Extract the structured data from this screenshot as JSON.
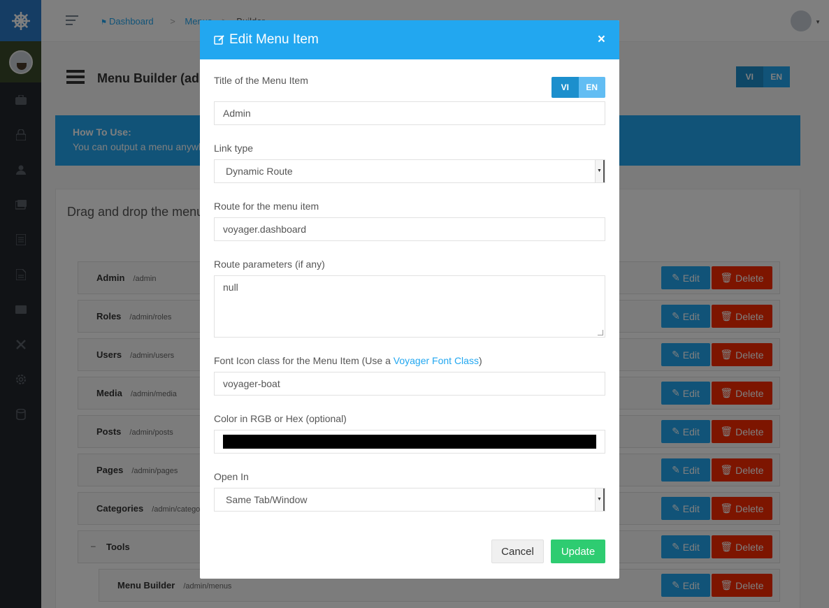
{
  "sidebar": {
    "logo_icon": "helm-icon",
    "items": [
      {
        "icon": "briefcase-icon"
      },
      {
        "icon": "lock-icon"
      },
      {
        "icon": "person-icon"
      },
      {
        "icon": "images-icon"
      },
      {
        "icon": "document-icon"
      },
      {
        "icon": "file-icon"
      },
      {
        "icon": "category-icon"
      },
      {
        "icon": "tools-icon"
      },
      {
        "icon": "gear-icon"
      },
      {
        "icon": "database-icon"
      }
    ]
  },
  "header": {
    "breadcrumb": [
      "Dashboard",
      "Menus",
      "Builder"
    ]
  },
  "page": {
    "title": "Menu Builder (admin)",
    "locales": [
      "VI",
      "EN"
    ]
  },
  "howto": {
    "title": "How To Use:",
    "text": "You can output a menu anywhere on your site by calling"
  },
  "panel": {
    "title": "Drag and drop the menu Items below to re-arrange them.",
    "rows": [
      {
        "title": "Admin",
        "url": "/admin"
      },
      {
        "title": "Roles",
        "url": "/admin/roles"
      },
      {
        "title": "Users",
        "url": "/admin/users"
      },
      {
        "title": "Media",
        "url": "/admin/media"
      },
      {
        "title": "Posts",
        "url": "/admin/posts"
      },
      {
        "title": "Pages",
        "url": "/admin/pages"
      },
      {
        "title": "Categories",
        "url": "/admin/categories"
      },
      {
        "title": "Tools",
        "url": ""
      },
      {
        "title": "Menu Builder",
        "url": "/admin/menus"
      }
    ],
    "edit_label": "Edit",
    "delete_label": "Delete"
  },
  "modal": {
    "title": "Edit Menu Item",
    "close": "×",
    "locales": [
      "VI",
      "EN"
    ],
    "fields": {
      "title_label": "Title of the Menu Item",
      "title_value": "Admin",
      "link_type_label": "Link type",
      "link_type_value": "Dynamic Route",
      "route_label": "Route for the menu item",
      "route_value": "voyager.dashboard",
      "params_label": "Route parameters (if any)",
      "params_value": "null",
      "icon_label_prefix": "Font Icon class for the Menu Item (Use a ",
      "icon_label_link": "Voyager Font Class",
      "icon_label_suffix": ")",
      "icon_value": "voyager-boat",
      "color_label": "Color in RGB or Hex (optional)",
      "color_value": "#000000",
      "open_in_label": "Open In",
      "open_in_value": "Same Tab/Window"
    },
    "cancel_label": "Cancel",
    "update_label": "Update"
  }
}
